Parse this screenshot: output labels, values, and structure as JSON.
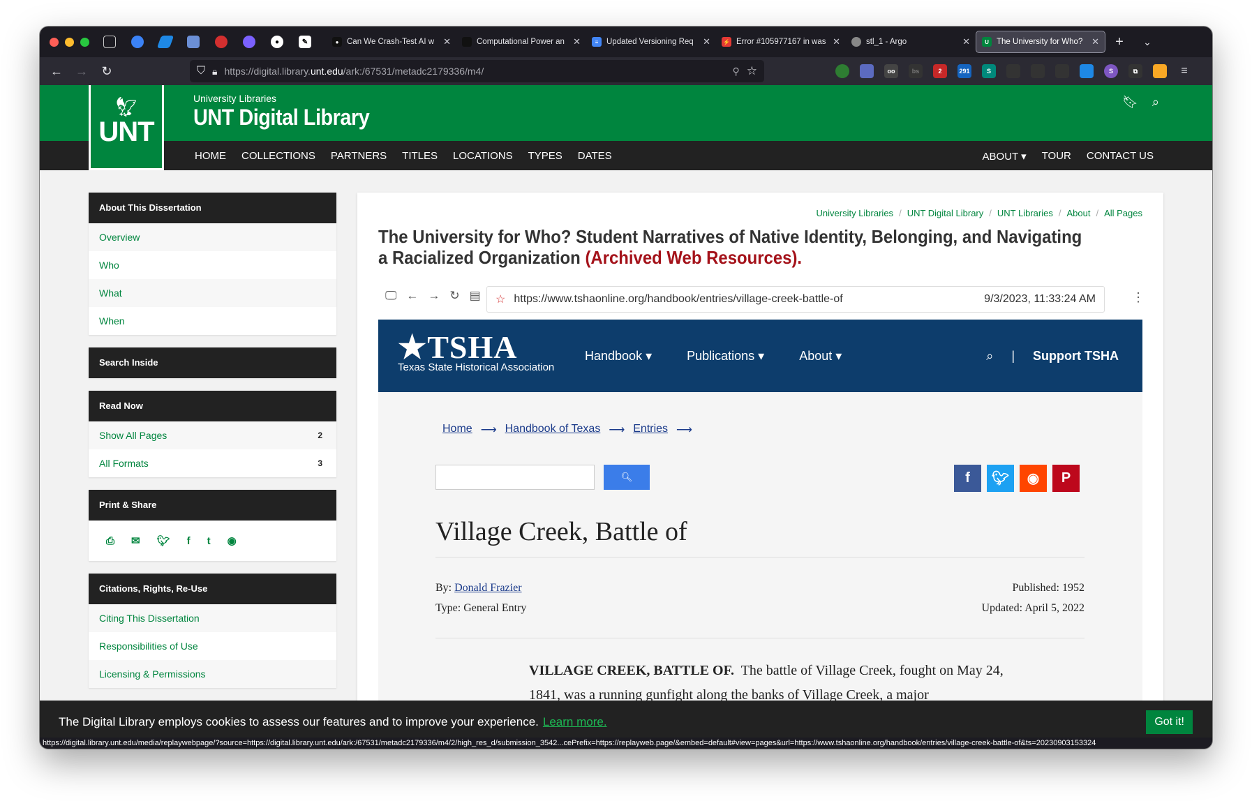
{
  "browser": {
    "tabs": [
      {
        "label": "Can We Crash-Test AI w",
        "fav_color": "#111"
      },
      {
        "label": "Computational Power an",
        "fav_color": "#111"
      },
      {
        "label": "Updated Versioning Req",
        "fav_color": "#4285f4"
      },
      {
        "label": "Error #105977167 in was",
        "fav_color": "#e53935"
      },
      {
        "label": "stl_1 - Argo",
        "fav_color": "#777"
      },
      {
        "label": "The University for Who?",
        "fav_color": "#00853e"
      }
    ],
    "url_prefix": "https://digital.library.",
    "url_domain": "unt.edu",
    "url_suffix": "/ark:/67531/metadc2179336/m4/",
    "status_url": "https://digital.library.unt.edu/media/replaywebpage/?source=https://digital.library.unt.edu/ark:/67531/metadc2179336/m4/2/high_res_d/submission_3542...cePrefix=https://replayweb.page/&embed=default#view=pages&url=https://www.tshaonline.org/handbook/entries/village-creek-battle-of&ts=20230903153324",
    "ext_badges": {
      "b1": "2",
      "b2": "291"
    }
  },
  "site": {
    "logo_text": "UNT",
    "sub1": "University Libraries",
    "sub2": "UNT Digital Library",
    "nav": [
      "HOME",
      "COLLECTIONS",
      "PARTNERS",
      "TITLES",
      "LOCATIONS",
      "TYPES",
      "DATES"
    ],
    "nav_right": [
      "ABOUT ▾",
      "TOUR",
      "CONTACT US"
    ]
  },
  "sidebar": {
    "about_head": "About This Dissertation",
    "about_items": [
      "Overview",
      "Who",
      "What",
      "When"
    ],
    "search_head": "Search Inside",
    "read_head": "Read Now",
    "read_items": [
      {
        "label": "Show All Pages",
        "count": "2"
      },
      {
        "label": "All Formats",
        "count": "3"
      }
    ],
    "print_head": "Print & Share",
    "cite_head": "Citations, Rights, Re-Use",
    "cite_items": [
      "Citing This Dissertation",
      "Responsibilities of Use",
      "Licensing & Permissions"
    ]
  },
  "main": {
    "crumbs": [
      "University Libraries",
      "UNT Digital Library",
      "UNT Libraries",
      "About",
      "All Pages"
    ],
    "title": "The University for Who? Student Narratives of Native Identity, Belonging, and Navigating a Racialized Organization",
    "title_red": "(Archived Web Resources).",
    "rw_url": "https://www.tshaonline.org/handbook/entries/village-creek-battle-of",
    "rw_date": "9/3/2023, 11:33:24 AM"
  },
  "tsha": {
    "logo": "TSHA",
    "logo_sub": "Texas State Historical Association",
    "nav": [
      "Handbook ▾",
      "Publications ▾",
      "About ▾"
    ],
    "support": "Support TSHA",
    "crumbs": [
      "Home",
      "Handbook of Texas",
      "Entries"
    ],
    "title": "Village Creek, Battle of",
    "by_label": "By: ",
    "author": "Donald Frazier",
    "type": "Type: General Entry",
    "published": "Published: 1952",
    "updated": "Updated: April 5, 2022",
    "lead": "VILLAGE CREEK, BATTLE OF.",
    "body": "The battle of Village Creek, fought on May 24, 1841, was a running gunfight along the banks of Village Creek, a major"
  },
  "cookie": {
    "msg": "The Digital Library employs cookies to assess our features and to improve your experience.",
    "link": "Learn more.",
    "button": "Got it!"
  }
}
